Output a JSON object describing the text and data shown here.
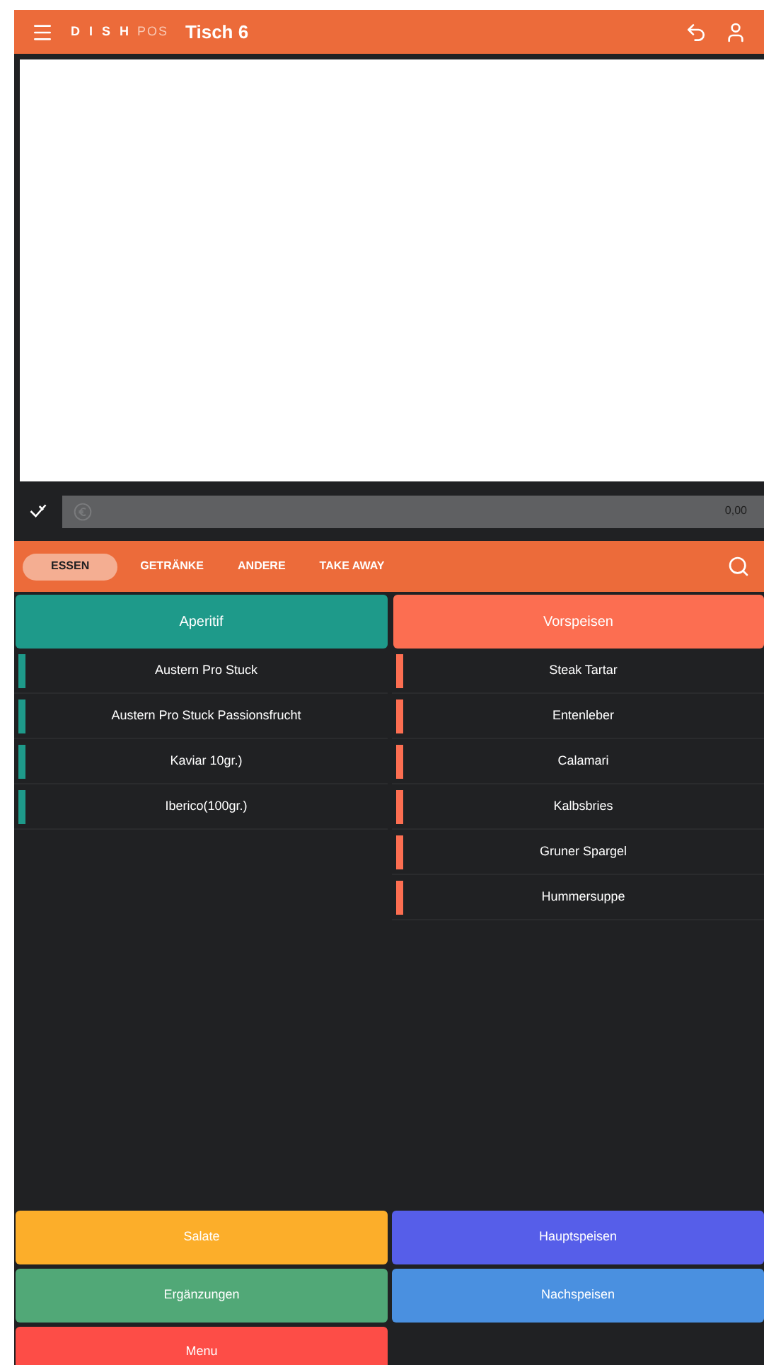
{
  "header": {
    "title": "Tisch 6",
    "logo_main": "D I S H",
    "logo_sub": "POS"
  },
  "amount_bar": {
    "value": "0,00"
  },
  "tabs": [
    {
      "label": "ESSEN",
      "selected": true
    },
    {
      "label": "GETRÄNKE",
      "selected": false
    },
    {
      "label": "ANDERE",
      "selected": false
    },
    {
      "label": "TAKE AWAY",
      "selected": false
    }
  ],
  "columns": [
    {
      "label": "Aperitif",
      "color": "#1e9a8a",
      "items": [
        "Austern Pro Stuck",
        "Austern Pro Stuck Passionsfrucht",
        "Kaviar 10gr.)",
        "Iberico(100gr.)"
      ]
    },
    {
      "label": "Vorspeisen",
      "color": "#fc6e51",
      "items": [
        "Steak Tartar",
        "Entenleber",
        "Calamari",
        "Kalbsbries",
        "Gruner Spargel",
        "Hummersuppe"
      ]
    }
  ],
  "more_categories": [
    {
      "label": "Salate",
      "color": "#fcae2a"
    },
    {
      "label": "Hauptspeisen",
      "color": "#565ee9"
    },
    {
      "label": "Ergänzungen",
      "color": "#51a877"
    },
    {
      "label": "Nachspeisen",
      "color": "#4a90e0"
    },
    {
      "label": "Menu",
      "color": "#fd4d47"
    }
  ]
}
